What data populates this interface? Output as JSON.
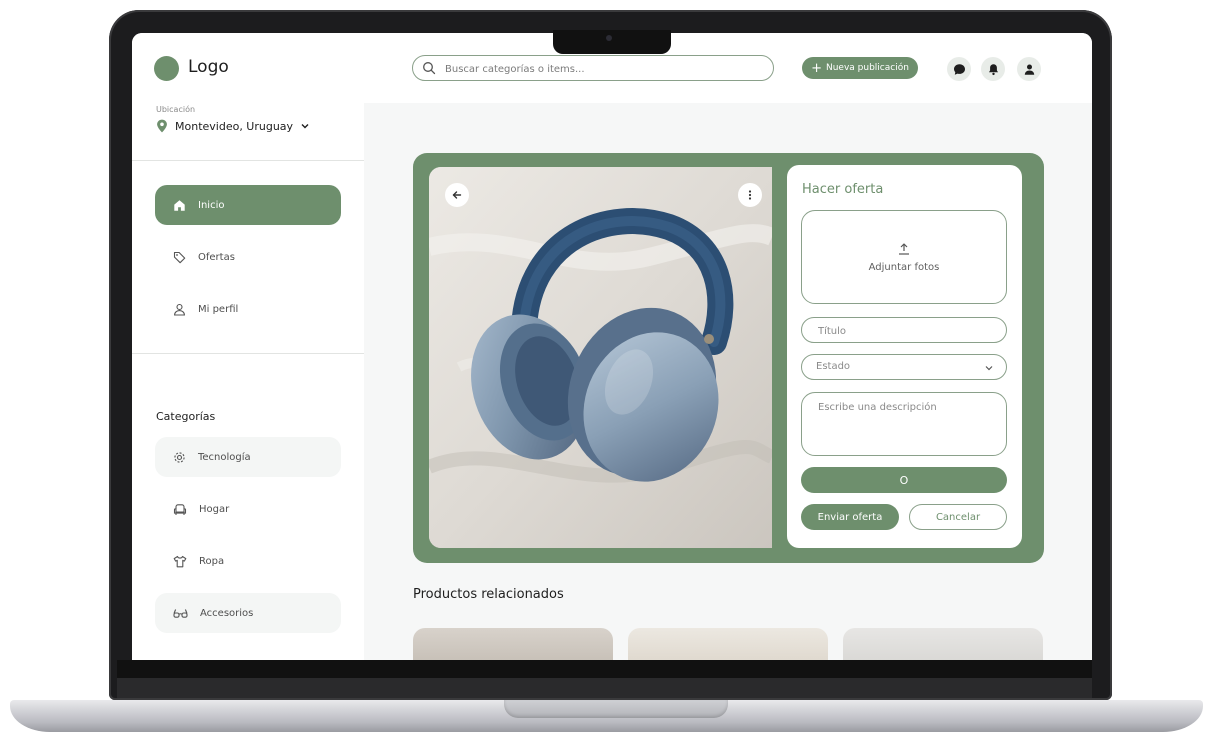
{
  "brand": {
    "logo_text": "Logo",
    "accent": "#6e8f6d"
  },
  "search": {
    "placeholder": "Buscar categorías o items..."
  },
  "header": {
    "new_post_label": "Nueva publicación",
    "icons": [
      "chat-icon",
      "bell-icon",
      "user-icon"
    ]
  },
  "location": {
    "label": "Ubicación",
    "value": "Montevideo, Uruguay"
  },
  "sidebar": {
    "nav": [
      {
        "label": "Inicio",
        "icon": "home-icon",
        "active": true
      },
      {
        "label": "Ofertas",
        "icon": "tag-icon"
      },
      {
        "label": "Mi perfil",
        "icon": "user-icon"
      }
    ],
    "categories_title": "Categorías",
    "categories": [
      {
        "label": "Tecnología",
        "icon": "gear-icon"
      },
      {
        "label": "Hogar",
        "icon": "armchair-icon"
      },
      {
        "label": "Ropa",
        "icon": "shirt-icon"
      },
      {
        "label": "Accesorios",
        "icon": "glasses-icon"
      }
    ]
  },
  "offer": {
    "title": "Hacer oferta",
    "upload_label": "Adjuntar fotos",
    "title_placeholder": "Título",
    "state_placeholder": "Estado",
    "description_placeholder": "Escribe una descripción",
    "bar_label": "O",
    "send_label": "Enviar oferta",
    "cancel_label": "Cancelar"
  },
  "related": {
    "title": "Productos relacionados"
  }
}
